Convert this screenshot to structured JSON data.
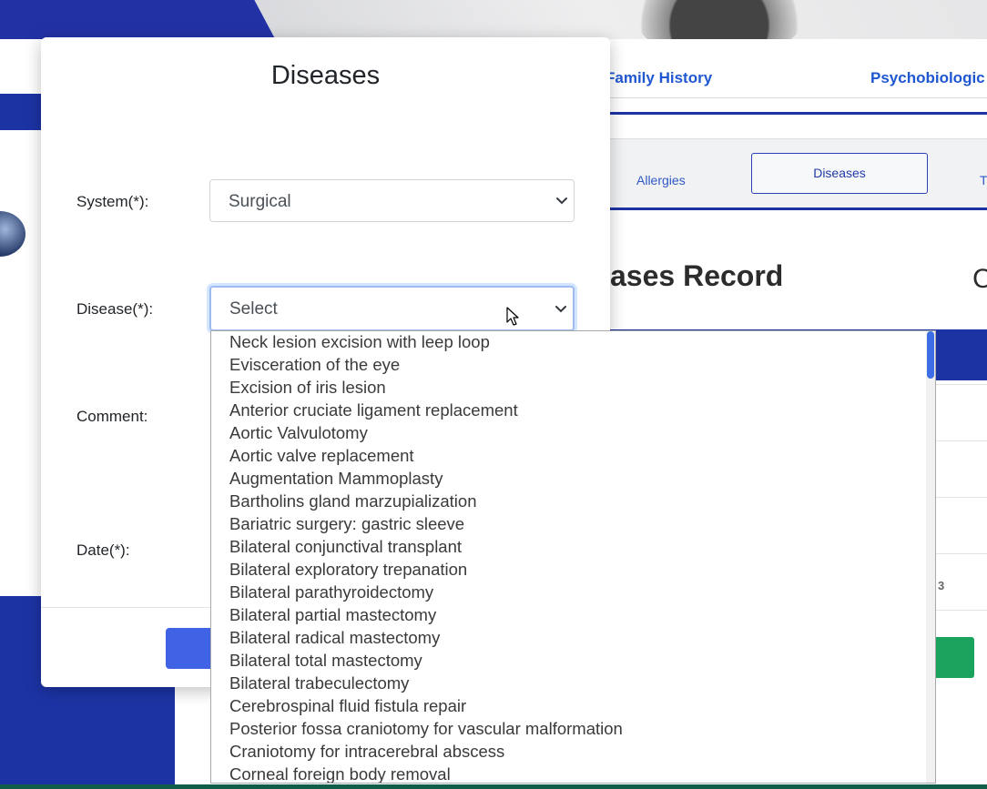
{
  "background": {
    "top_tabs": [
      "Family History",
      "Psychobiologic"
    ],
    "sub_tabs": [
      "Allergies",
      "Diseases",
      "T"
    ],
    "active_sub_tab": "Diseases",
    "record_heading": "ases Record",
    "record_heading_right": "C",
    "table_number": "3"
  },
  "modal": {
    "title": "Diseases",
    "system_label": "System(*):",
    "system_value": "Surgical",
    "disease_label": "Disease(*):",
    "disease_value": "Select",
    "comment_label": "Comment:",
    "date_label": "Date(*):"
  },
  "dropdown": {
    "options": [
      "Neck lesion excision with leep loop",
      "Evisceration of the eye",
      "Excision of iris lesion",
      "Anterior cruciate ligament replacement",
      "Aortic Valvulotomy",
      "Aortic valve replacement",
      "Augmentation Mammoplasty",
      "Bartholins gland marzupialization",
      "Bariatric surgery: gastric sleeve",
      "Bilateral conjunctival transplant",
      "Bilateral exploratory trepanation",
      "Bilateral parathyroidectomy",
      "Bilateral partial mastectomy",
      "Bilateral radical mastectomy",
      "Bilateral total mastectomy",
      "Bilateral trabeculectomy",
      "Cerebrospinal fluid fistula repair",
      "Posterior fossa craniotomy for vascular malformation",
      "Craniotomy for intracerebral abscess",
      "Corneal foreign body removal"
    ]
  },
  "colors": {
    "brand_blue": "#1c33a4",
    "link_blue": "#1f57d1",
    "primary_button": "#3f63e4",
    "success_button": "#1aa35c",
    "scroll_thumb": "#3d6ee8"
  }
}
